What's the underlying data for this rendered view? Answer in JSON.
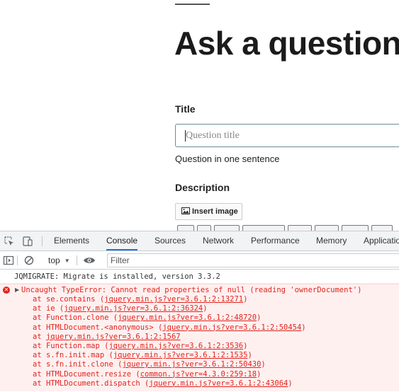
{
  "page": {
    "title": "Ask a question",
    "title_label": "Title",
    "title_input": {
      "value": "",
      "placeholder": "Question title"
    },
    "title_hint": "Question in one sentence",
    "description_label": "Description",
    "insert_image_label": "Insert image"
  },
  "devtools": {
    "tabs": [
      {
        "label": "Elements",
        "active": false
      },
      {
        "label": "Console",
        "active": true
      },
      {
        "label": "Sources",
        "active": false
      },
      {
        "label": "Network",
        "active": false
      },
      {
        "label": "Performance",
        "active": false
      },
      {
        "label": "Memory",
        "active": false
      },
      {
        "label": "Application",
        "active": false
      }
    ],
    "context": "top",
    "filter_placeholder": "Filter",
    "console": {
      "info": "JQMIGRATE: Migrate is installed, version 3.3.2",
      "error": {
        "message": "Uncaught TypeError: Cannot read properties of null (reading 'ownerDocument')",
        "frames": [
          {
            "fn": "at se.contains (",
            "link": "jquery.min.js?ver=3.6.1:2:13271",
            "close": ")"
          },
          {
            "fn": "at ie (",
            "link": "jquery.min.js?ver=3.6.1:2:36324",
            "close": ")"
          },
          {
            "fn": "at Function.clone (",
            "link": "jquery.min.js?ver=3.6.1:2:48720",
            "close": ")"
          },
          {
            "fn": "at HTMLDocument.<anonymous> (",
            "link": "jquery.min.js?ver=3.6.1:2:50454",
            "close": ")"
          },
          {
            "fn": "at ",
            "link": "jquery.min.js?ver=3.6.1:2:1567",
            "close": ""
          },
          {
            "fn": "at Function.map (",
            "link": "jquery.min.js?ver=3.6.1:2:3536",
            "close": ")"
          },
          {
            "fn": "at s.fn.init.map (",
            "link": "jquery.min.js?ver=3.6.1:2:1535",
            "close": ")"
          },
          {
            "fn": "at s.fn.init.clone (",
            "link": "jquery.min.js?ver=3.6.1:2:50430",
            "close": ")"
          },
          {
            "fn": "at HTMLDocument.resize (",
            "link": "common.js?ver=4.3.0:259:18",
            "close": ")"
          },
          {
            "fn": "at HTMLDocument.dispatch (",
            "link": "jquery.min.js?ver=3.6.1:2:43064",
            "close": ")"
          }
        ]
      }
    }
  },
  "colors": {
    "accent": "#1a73e8",
    "error": "#e0241d",
    "error_bg": "#fff0f0"
  }
}
